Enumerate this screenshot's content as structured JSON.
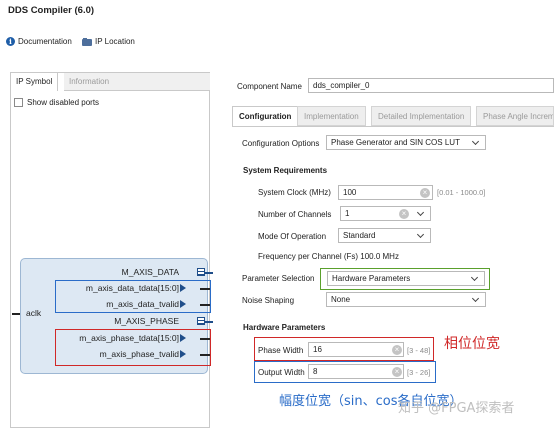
{
  "window": {
    "title": "DDS Compiler (6.0)"
  },
  "toolbar": {
    "documentation": "Documentation",
    "ip_location": "IP Location"
  },
  "left_panel": {
    "tabs": [
      "IP Symbol",
      "Information"
    ],
    "show_disabled_ports": "Show disabled ports",
    "symbol": {
      "input_port": "aclk",
      "ports": [
        "M_AXIS_DATA",
        "m_axis_data_tdata[15:0]",
        "m_axis_data_tvalid",
        "M_AXIS_PHASE",
        "m_axis_phase_tdata[15:0]",
        "m_axis_phase_tvalid"
      ]
    }
  },
  "right_panel": {
    "component_name_label": "Component Name",
    "component_name_value": "dds_compiler_0",
    "tabs": [
      "Configuration",
      "Implementation",
      "Detailed Implementation",
      "Phase Angle Increm"
    ],
    "config_options_label": "Configuration Options",
    "config_options_value": "Phase Generator and SIN COS LUT",
    "system_requirements": "System Requirements",
    "system_clock_label": "System Clock (MHz)",
    "system_clock_value": "100",
    "system_clock_range": "[0.01 - 1000.0]",
    "num_channels_label": "Number of Channels",
    "num_channels_value": "1",
    "mode_label": "Mode Of Operation",
    "mode_value": "Standard",
    "freq_per_channel": "Frequency per Channel (Fs) 100.0 MHz",
    "param_selection_label": "Parameter Selection",
    "param_selection_value": "Hardware Parameters",
    "noise_shaping_label": "Noise Shaping",
    "noise_shaping_value": "None",
    "hardware_parameters": "Hardware Parameters",
    "phase_width_label": "Phase Width",
    "phase_width_value": "16",
    "phase_width_range": "[3 - 48]",
    "output_width_label": "Output Width",
    "output_width_value": "8",
    "output_width_range": "[3 - 26]"
  },
  "annotations": {
    "phase_width_note": "相位位宽",
    "output_width_note": "幅度位宽（sin、cos各自位宽）",
    "watermark": "知乎 @FPGA探索者"
  }
}
